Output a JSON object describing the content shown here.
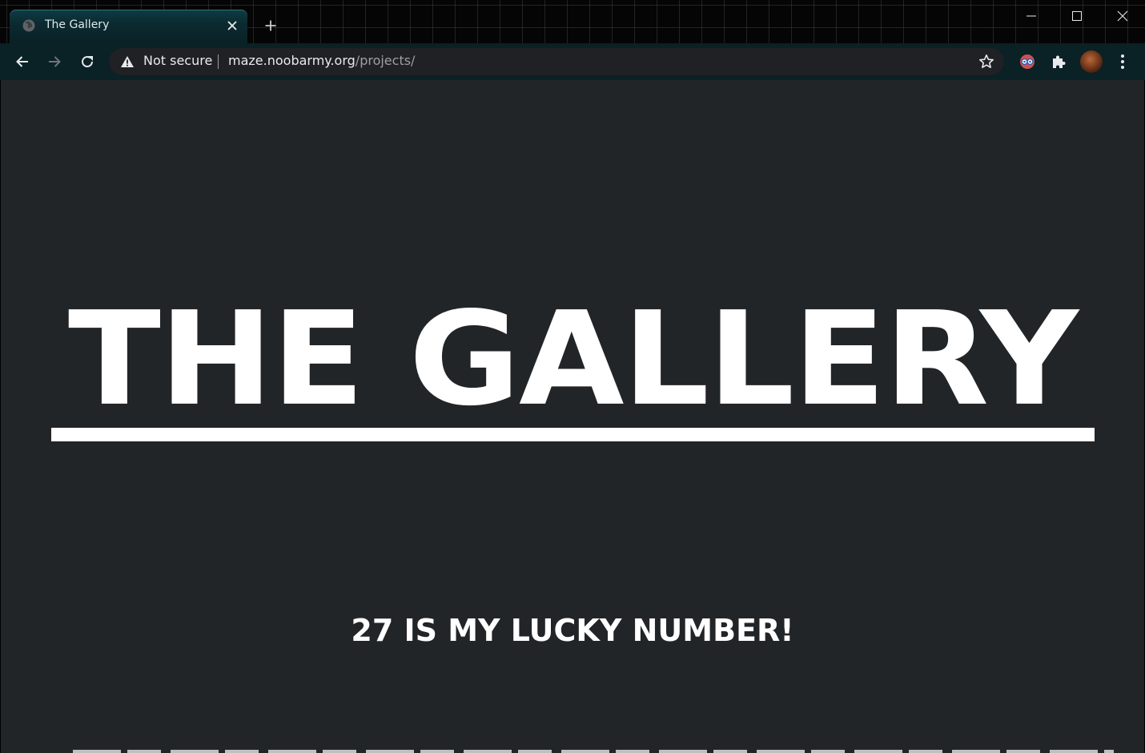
{
  "browser": {
    "tab": {
      "title": "The Gallery",
      "favicon": "globe-icon"
    },
    "new_tab_icon": "plus-icon",
    "window_controls": [
      "minimize-icon",
      "maximize-icon",
      "close-icon"
    ],
    "toolbar": {
      "back_icon": "arrow-left-icon",
      "forward_icon": "arrow-right-icon",
      "reload_icon": "reload-icon",
      "security_label": "Not secure",
      "url_host": "maze.noobarmy.org",
      "url_path": "/projects/",
      "bookmark_icon": "star-icon",
      "extensions": [
        "goggles-extension-icon",
        "puzzle-icon"
      ],
      "menu_icon": "kebab-menu-icon"
    }
  },
  "page": {
    "title": "THE GALLERY",
    "tagline": "27 IS MY LUCKY NUMBER!",
    "background": "#222528",
    "text_color": "#ffffff"
  },
  "theme": {
    "accent": "#0a2125",
    "tab_color": "#0f3c44"
  }
}
